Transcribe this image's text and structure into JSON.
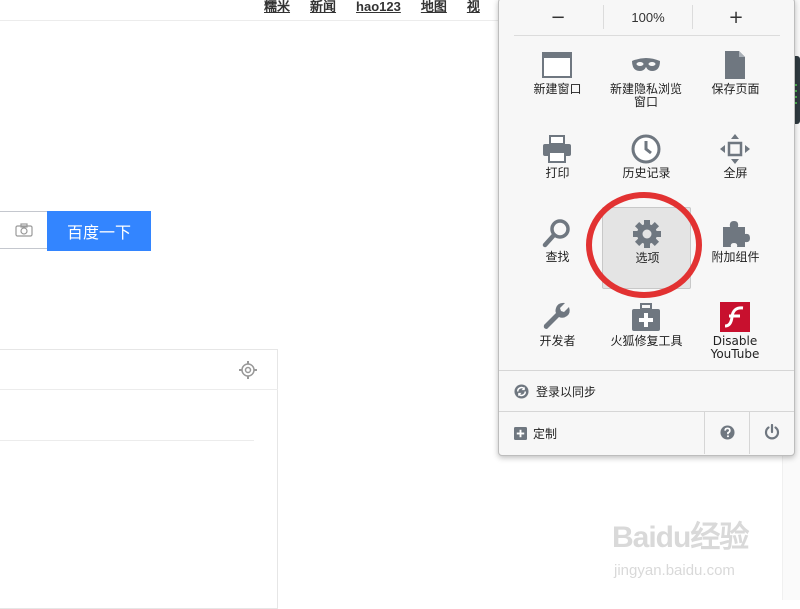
{
  "nav": {
    "items": [
      "糯米",
      "新闻",
      "hao123",
      "地图",
      "视"
    ]
  },
  "search": {
    "button_label": "百度一下"
  },
  "menu": {
    "zoom": {
      "minus": "−",
      "value": "100%",
      "plus": "+"
    },
    "items": [
      {
        "label": "新建窗口",
        "icon": "window-icon"
      },
      {
        "label": "新建隐私浏览窗口",
        "icon": "mask-icon"
      },
      {
        "label": "保存页面",
        "icon": "page-icon"
      },
      {
        "label": "打印",
        "icon": "printer-icon"
      },
      {
        "label": "历史记录",
        "icon": "clock-icon"
      },
      {
        "label": "全屏",
        "icon": "fullscreen-icon"
      },
      {
        "label": "查找",
        "icon": "magnifier-icon"
      },
      {
        "label": "选项",
        "icon": "gear-icon"
      },
      {
        "label": "附加组件",
        "icon": "puzzle-icon"
      },
      {
        "label": "开发者",
        "icon": "wrench-icon"
      },
      {
        "label": "火狐修复工具",
        "icon": "toolkit-icon"
      },
      {
        "label": "Disable YouTube",
        "icon": "flash-icon"
      }
    ],
    "sync_label": "登录以同步",
    "customize_label": "定制"
  },
  "watermark": {
    "brand": "Baidu经验",
    "url": "jingyan.baidu.com"
  },
  "colors": {
    "accent": "#3385ff",
    "highlight_circle": "#e23232",
    "flash": "#c8102e"
  }
}
